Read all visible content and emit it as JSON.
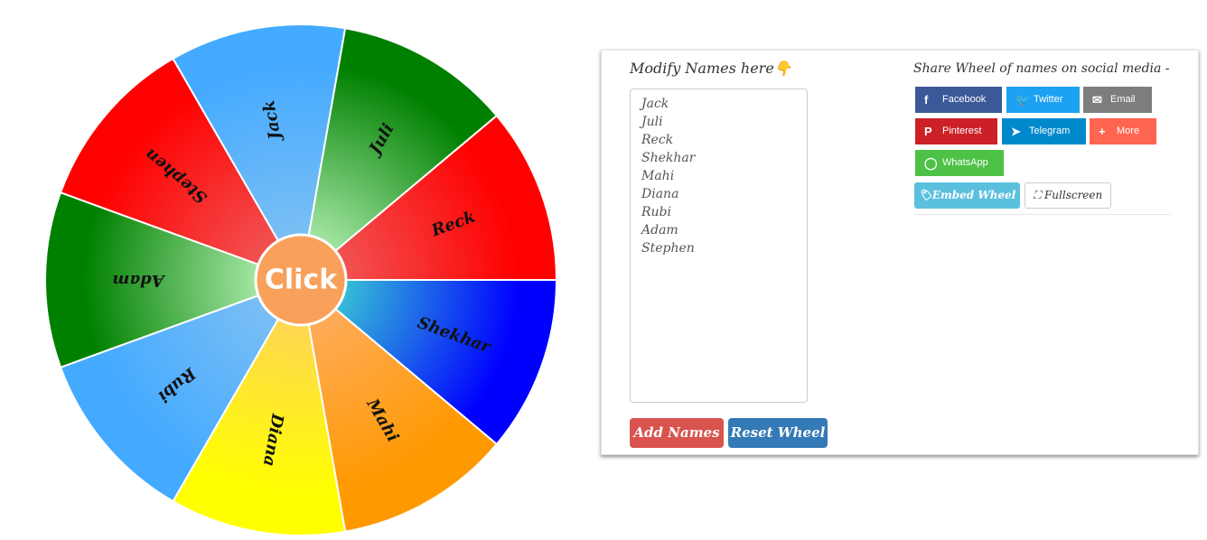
{
  "wheel": {
    "center_label": "Click",
    "segments": [
      {
        "name": "Shekhar",
        "c1": "#44eecc",
        "c2": "#0000ff"
      },
      {
        "name": "Mahi",
        "c1": "#ffb070",
        "c2": "#ff9900"
      },
      {
        "name": "Diana",
        "c1": "#ffcc66",
        "c2": "#ffff00"
      },
      {
        "name": "Rubi",
        "c1": "#88c4f2",
        "c2": "#44aaff"
      },
      {
        "name": "Adam",
        "c1": "#ccffcc",
        "c2": "#008000"
      },
      {
        "name": "Stephen",
        "c1": "#ee6666",
        "c2": "#ff0000"
      },
      {
        "name": "Jack",
        "c1": "#88c4f2",
        "c2": "#44aaff"
      },
      {
        "name": "Juli",
        "c1": "#ccffcc",
        "c2": "#008000"
      },
      {
        "name": "Reck",
        "c1": "#ee6666",
        "c2": "#ff0000"
      }
    ]
  },
  "modify": {
    "title": "Modify Names here👇",
    "names": "Jack\nJuli\nReck\nShekhar\nMahi\nDiana\nRubi\nAdam\nStephen",
    "add_label": "Add Names",
    "reset_label": "Reset Wheel"
  },
  "share": {
    "title": "Share Wheel of names on social media -",
    "buttons": [
      {
        "label": "Facebook",
        "icon": "f",
        "color": "#3b5998"
      },
      {
        "label": "Twitter",
        "icon": "🐦",
        "color": "#1da1f2"
      },
      {
        "label": "Email",
        "icon": "✉",
        "color": "#7d7d7d"
      },
      {
        "label": "Pinterest",
        "icon": "P",
        "color": "#cb2027"
      },
      {
        "label": "Telegram",
        "icon": "➤",
        "color": "#0088cc"
      },
      {
        "label": "More",
        "icon": "+",
        "color": "#ff6550"
      },
      {
        "label": "WhatsApp",
        "icon": "◯",
        "color": "#4dc247"
      }
    ],
    "embed_label": "🏷Embed Wheel",
    "fullscreen_label": "⛶ Fullscreen"
  }
}
